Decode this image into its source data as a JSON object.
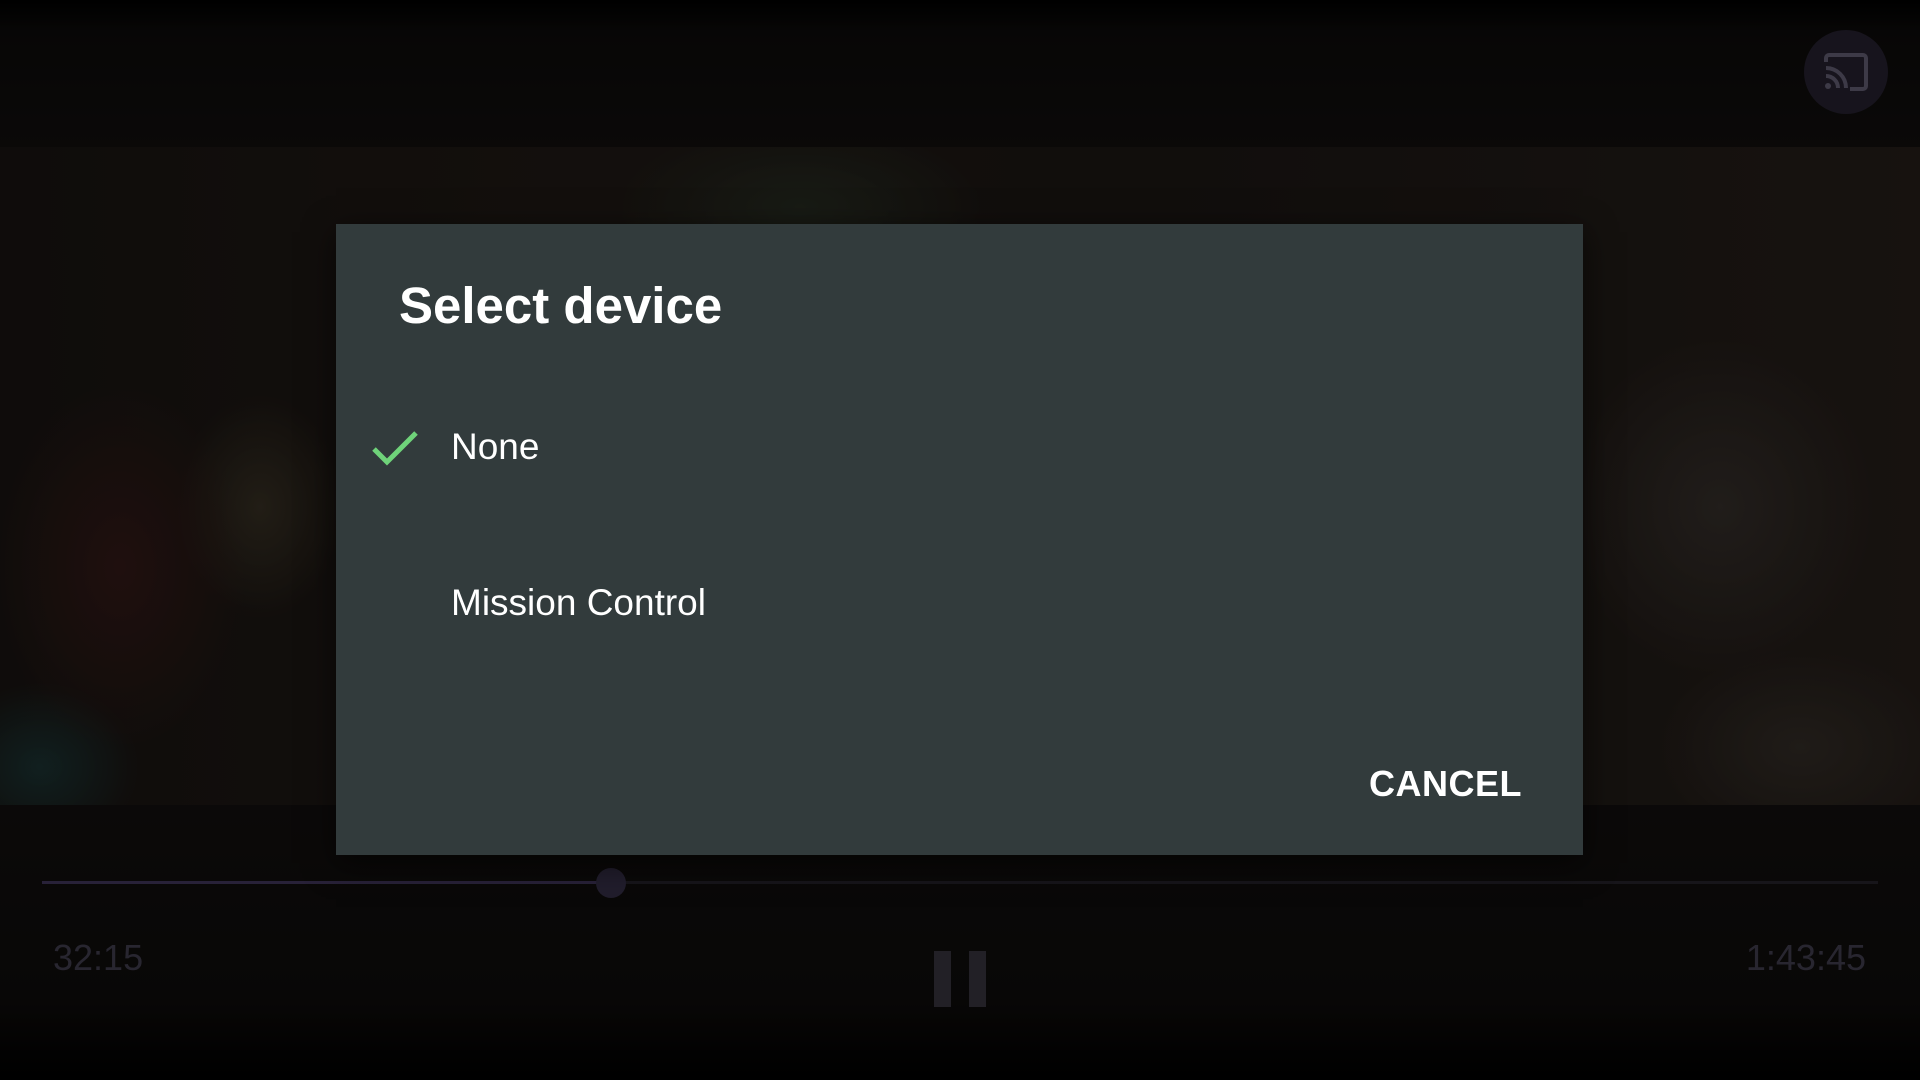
{
  "dialog": {
    "title": "Select device",
    "devices": [
      {
        "label": "None",
        "selected": true,
        "icon": "check-icon"
      },
      {
        "label": "Mission Control",
        "selected": false
      }
    ],
    "cancel_label": "CANCEL"
  },
  "player": {
    "elapsed": "32:15",
    "total": "1:43:45",
    "progress_fraction": 0.31,
    "cast_icon": "cast-icon",
    "pause_icon": "pause-icon"
  },
  "colors": {
    "dialog_background": "#323b3c",
    "check_accent": "#6fd37a",
    "seek_fill": "#4a3d66"
  }
}
